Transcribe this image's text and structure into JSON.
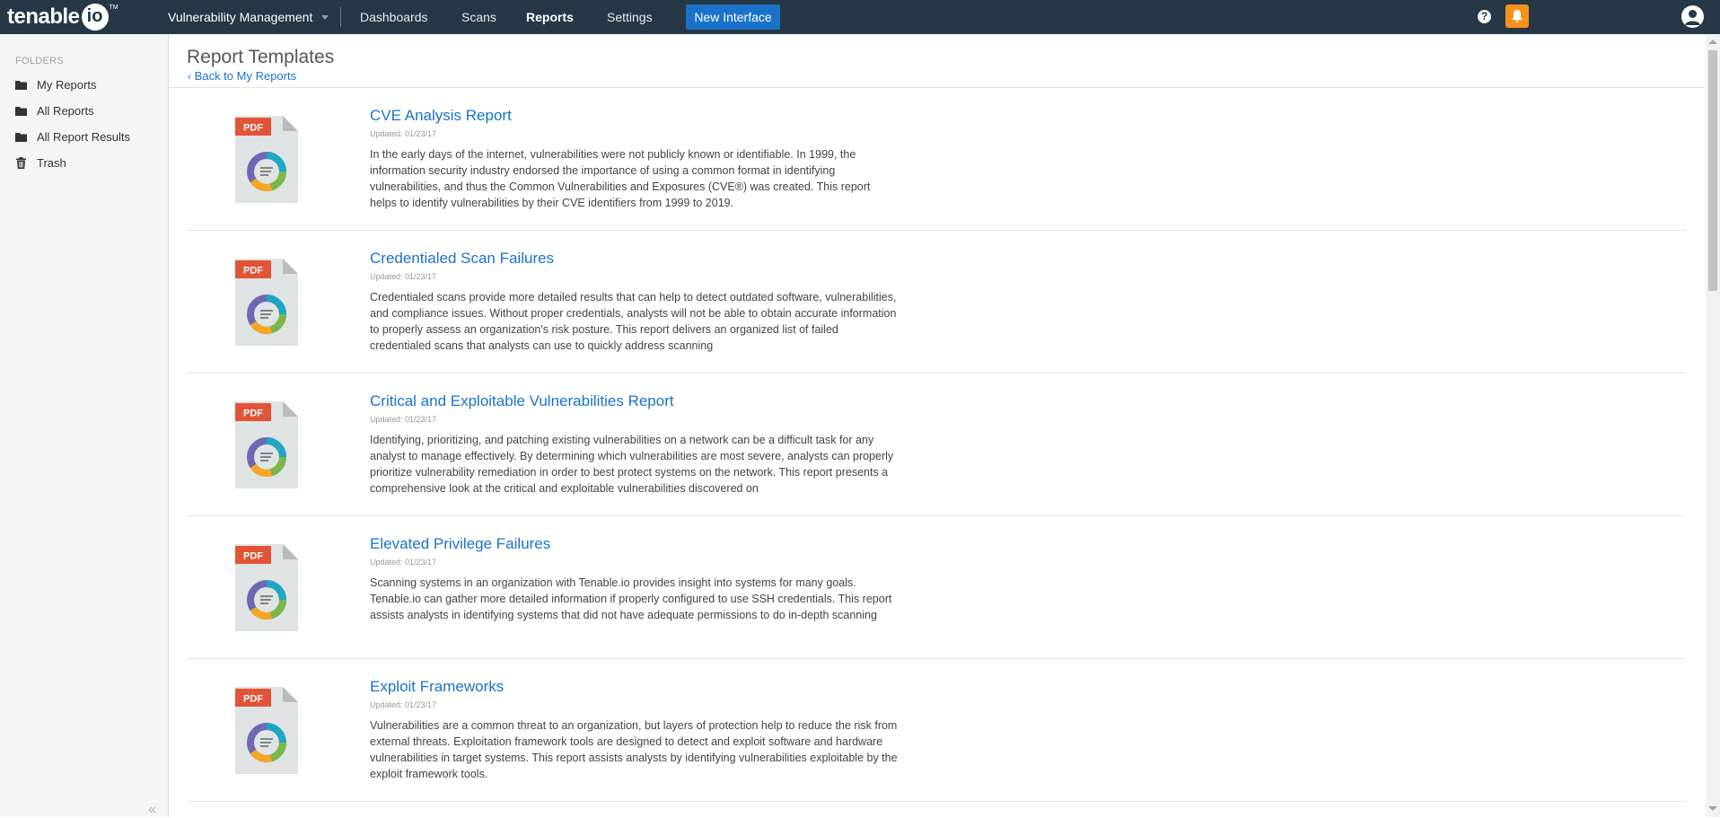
{
  "header": {
    "logo": {
      "text": "tenable",
      "io": "io",
      "tm": "TM"
    },
    "product": "Vulnerability Management",
    "nav": [
      {
        "label": "Dashboards"
      },
      {
        "label": "Scans"
      },
      {
        "label": "Reports",
        "active": true
      },
      {
        "label": "Settings"
      }
    ],
    "new_interface_label": "New Interface",
    "help_glyph": "?",
    "accent_color": "#f6921e",
    "bar_color": "#263746",
    "button_color": "#1a73c9"
  },
  "sidebar": {
    "section_label": "FOLDERS",
    "items": [
      {
        "label": "My Reports",
        "icon": "folder-icon"
      },
      {
        "label": "All Reports",
        "icon": "folder-icon"
      },
      {
        "label": "All Report Results",
        "icon": "folder-icon"
      },
      {
        "label": "Trash",
        "icon": "trash-icon"
      }
    ],
    "collapse_glyph": "«"
  },
  "main": {
    "title": "Report Templates",
    "back_link": "Back to My Reports",
    "reports": [
      {
        "title": "CVE Analysis Report",
        "updated": "Updated: 01/23/17",
        "badge": "PDF",
        "description": "In the early days of the internet, vulnerabilities were not publicly known or identifiable. In 1999, the information security industry endorsed the importance of using a common format in identifying vulnerabilities, and thus the Common Vulnerabilities and Exposures (CVE®) was created. This report helps to identify vulnerabilities by their CVE identifiers from 1999 to 2019."
      },
      {
        "title": "Credentialed Scan Failures",
        "updated": "Updated: 01/23/17",
        "badge": "PDF",
        "description": "Credentialed scans provide more detailed results that can help to detect outdated software, vulnerabilities, and compliance issues. Without proper credentials, analysts will not be able to obtain accurate information to properly assess an organization's risk posture. This report delivers an organized list of failed credentialed scans that analysts can use to quickly address scanning"
      },
      {
        "title": "Critical and Exploitable Vulnerabilities Report",
        "updated": "Updated: 01/23/17",
        "badge": "PDF",
        "description": "Identifying, prioritizing, and patching existing vulnerabilities on a network can be a difficult task for any analyst to manage effectively. By determining which vulnerabilities are most severe, analysts can properly prioritize vulnerability remediation in order to best protect systems on the network. This report presents a comprehensive look at the critical and exploitable vulnerabilities discovered on"
      },
      {
        "title": "Elevated Privilege Failures",
        "updated": "Updated: 01/23/17",
        "badge": "PDF",
        "description": "Scanning systems in an organization with Tenable.io provides insight into systems for many goals. Tenable.io can gather more detailed information if properly configured to use SSH credentials. This report assists analysts in identifying systems that did not have adequate permissions to do in-depth scanning"
      },
      {
        "title": "Exploit Frameworks",
        "updated": "Updated: 01/23/17",
        "badge": "PDF",
        "description": "Vulnerabilities are a common threat to an organization, but layers of protection help to reduce the risk from external threats. Exploitation framework tools are designed to detect and exploit software and hardware vulnerabilities in target systems. This report assists analysts by identifying vulnerabilities exploitable by the exploit framework tools."
      }
    ]
  }
}
